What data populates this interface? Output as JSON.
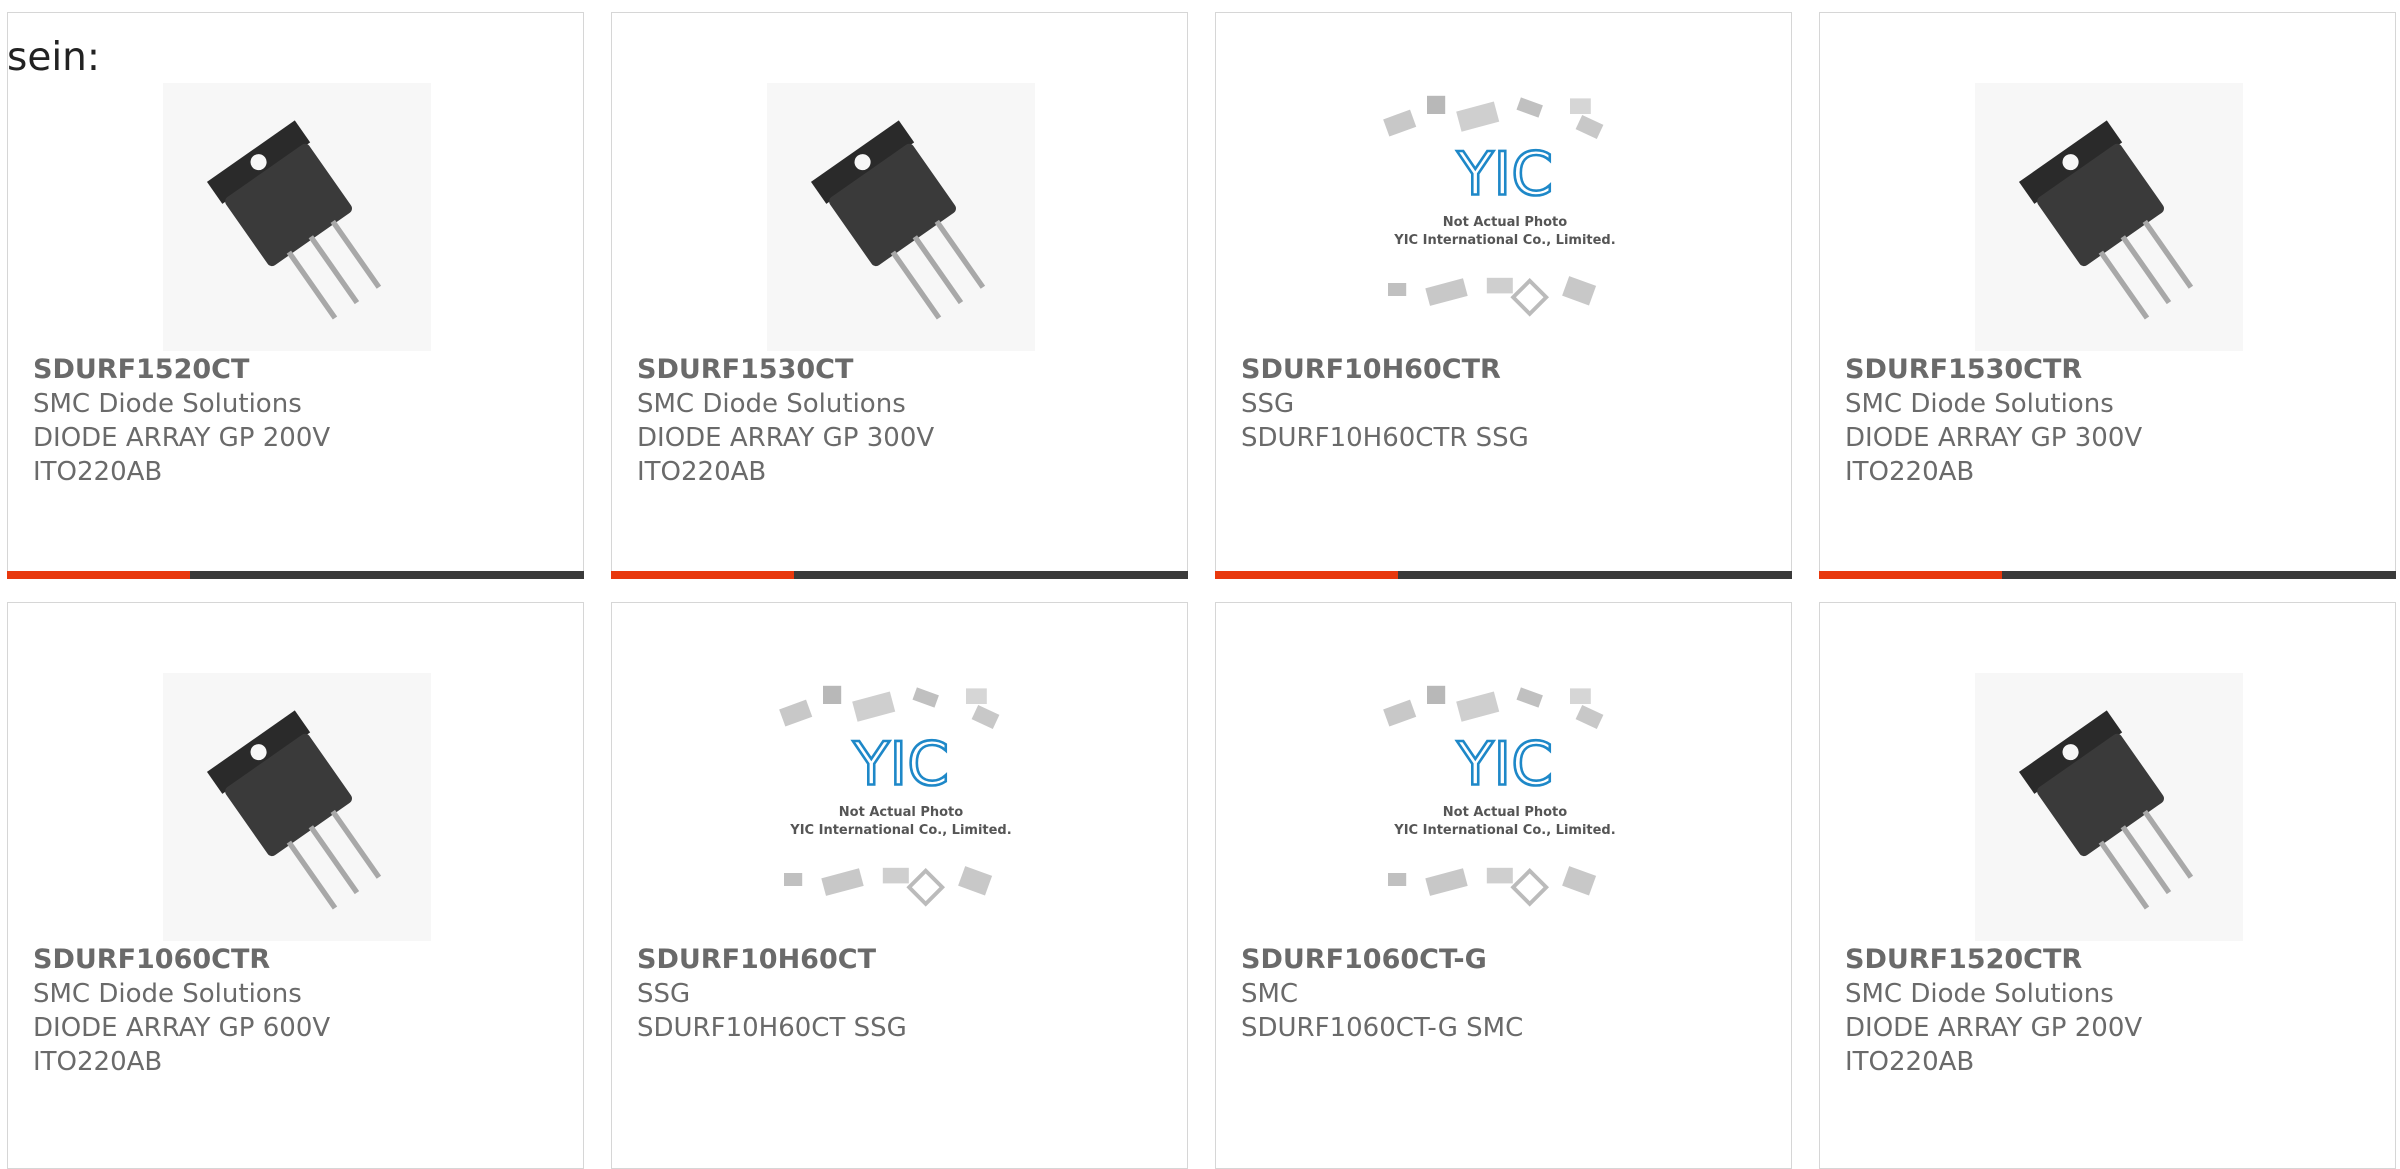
{
  "heading": "sein:",
  "colors": {
    "accent": "#e8380d",
    "bar": "#3a3a3a",
    "text": "#6a6a6a",
    "border": "#d6d6d6"
  },
  "products": [
    {
      "part": "SDURF1520CT",
      "manufacturer": "SMC Diode Solutions",
      "desc1": "DIODE ARRAY GP 200V",
      "desc2": "ITO220AB",
      "image": "transistor-photo"
    },
    {
      "part": "SDURF1530CT",
      "manufacturer": "SMC Diode Solutions",
      "desc1": "DIODE ARRAY GP 300V",
      "desc2": "ITO220AB",
      "image": "transistor-photo"
    },
    {
      "part": "SDURF10H60CTR",
      "manufacturer": "SSG",
      "desc1": "SDURF10H60CTR SSG",
      "desc2": "",
      "image": "not-actual-photo",
      "placeholder_line1": "Not Actual Photo",
      "placeholder_line2": "YIC International Co., Limited.",
      "placeholder_logo": "YIC"
    },
    {
      "part": "SDURF1530CTR",
      "manufacturer": "SMC Diode Solutions",
      "desc1": "DIODE ARRAY GP 300V",
      "desc2": "ITO220AB",
      "image": "transistor-photo"
    },
    {
      "part": "SDURF1060CTR",
      "manufacturer": "SMC Diode Solutions",
      "desc1": "DIODE ARRAY GP 600V",
      "desc2": "ITO220AB",
      "image": "transistor-photo"
    },
    {
      "part": "SDURF10H60CT",
      "manufacturer": "SSG",
      "desc1": "SDURF10H60CT SSG",
      "desc2": "",
      "image": "not-actual-photo",
      "placeholder_line1": "Not Actual Photo",
      "placeholder_line2": "YIC International Co., Limited.",
      "placeholder_logo": "YIC"
    },
    {
      "part": "SDURF1060CT-G",
      "manufacturer": "SMC",
      "desc1": "SDURF1060CT-G SMC",
      "desc2": "",
      "image": "not-actual-photo",
      "placeholder_line1": "Not Actual Photo",
      "placeholder_line2": "YIC International Co., Limited.",
      "placeholder_logo": "YIC"
    },
    {
      "part": "SDURF1520CTR",
      "manufacturer": "SMC Diode Solutions",
      "desc1": "DIODE ARRAY GP 200V",
      "desc2": "ITO220AB",
      "image": "transistor-photo"
    }
  ]
}
